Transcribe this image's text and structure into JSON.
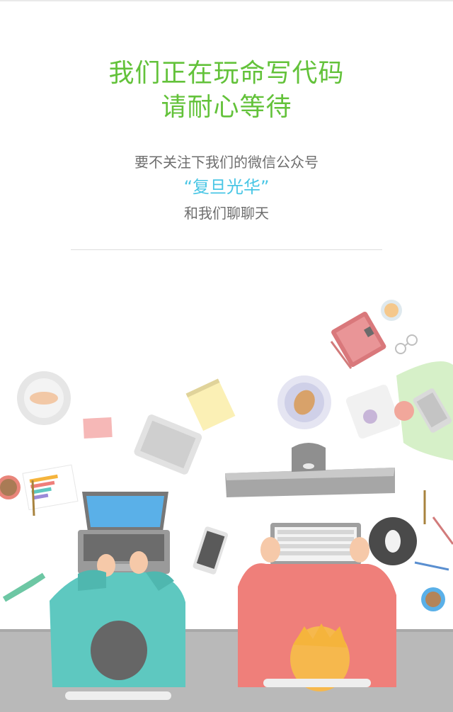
{
  "headline": {
    "line1": "我们正在玩命写代码",
    "line2": "请耐心等待"
  },
  "subtext": {
    "line1": "要不关注下我们的微信公众号",
    "brand": "“复旦光华”",
    "line3": "和我们聊聊天"
  },
  "colors": {
    "headline": "#63c23a",
    "brand": "#49c6e5",
    "subtext": "#6e6e6e",
    "desk_floor": "#b9b9b9",
    "person_left_shirt": "#5ec8c0",
    "person_right_shirt": "#ef7f7a",
    "hair_left": "#6b6b6b",
    "hair_right": "#f5b43c",
    "skin": "#f6c9a9"
  },
  "illustration": {
    "subject": "two-people-coding-at-desk",
    "icons": [
      "laptop-icon",
      "keyboard-icon",
      "monitor-icon",
      "mouse-icon",
      "tablet-icon",
      "phone-icon",
      "notepad-icon",
      "notebook-icon",
      "coffee-cup-icon",
      "plate-icon",
      "triangle-ruler-icon",
      "pencil-icon",
      "glasses-icon",
      "chart-sheet-icon"
    ]
  }
}
